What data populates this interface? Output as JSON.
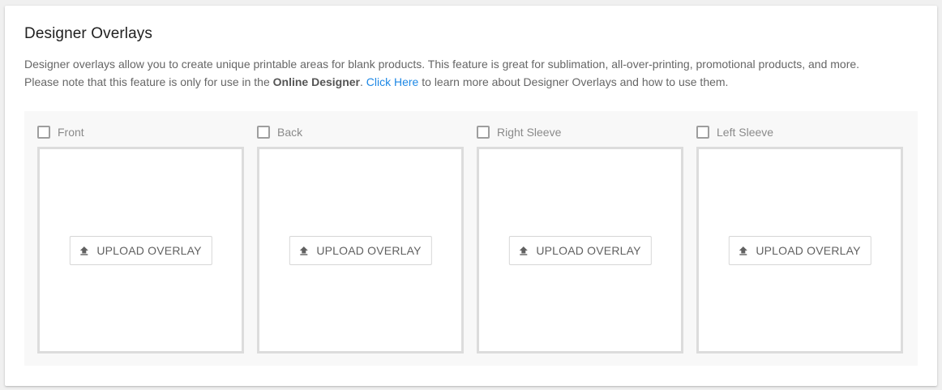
{
  "section": {
    "title": "Designer Overlays",
    "description_line1": "Designer overlays allow you to create unique printable areas for blank products. This feature is great for sublimation, all-over-printing, promotional products, and more.",
    "description_line2_prefix": "Please note that this feature is only for use in the ",
    "description_line2_bold": "Online Designer",
    "description_line2_dot": ". ",
    "description_line2_link": "Click Here",
    "description_line2_suffix": " to learn more about Designer Overlays and how to use them."
  },
  "overlays": [
    {
      "label": "Front",
      "checked": false,
      "button_label": "UPLOAD OVERLAY"
    },
    {
      "label": "Back",
      "checked": false,
      "button_label": "UPLOAD OVERLAY"
    },
    {
      "label": "Right Sleeve",
      "checked": false,
      "button_label": "UPLOAD OVERLAY"
    },
    {
      "label": "Left Sleeve",
      "checked": false,
      "button_label": "UPLOAD OVERLAY"
    }
  ],
  "colors": {
    "link": "#1e88e5",
    "box_border": "#dcdcdc",
    "panel_bg": "#f8f8f8"
  },
  "icons": {
    "upload": "upload-arrow-icon",
    "checkbox": "checkbox-unchecked-icon"
  }
}
